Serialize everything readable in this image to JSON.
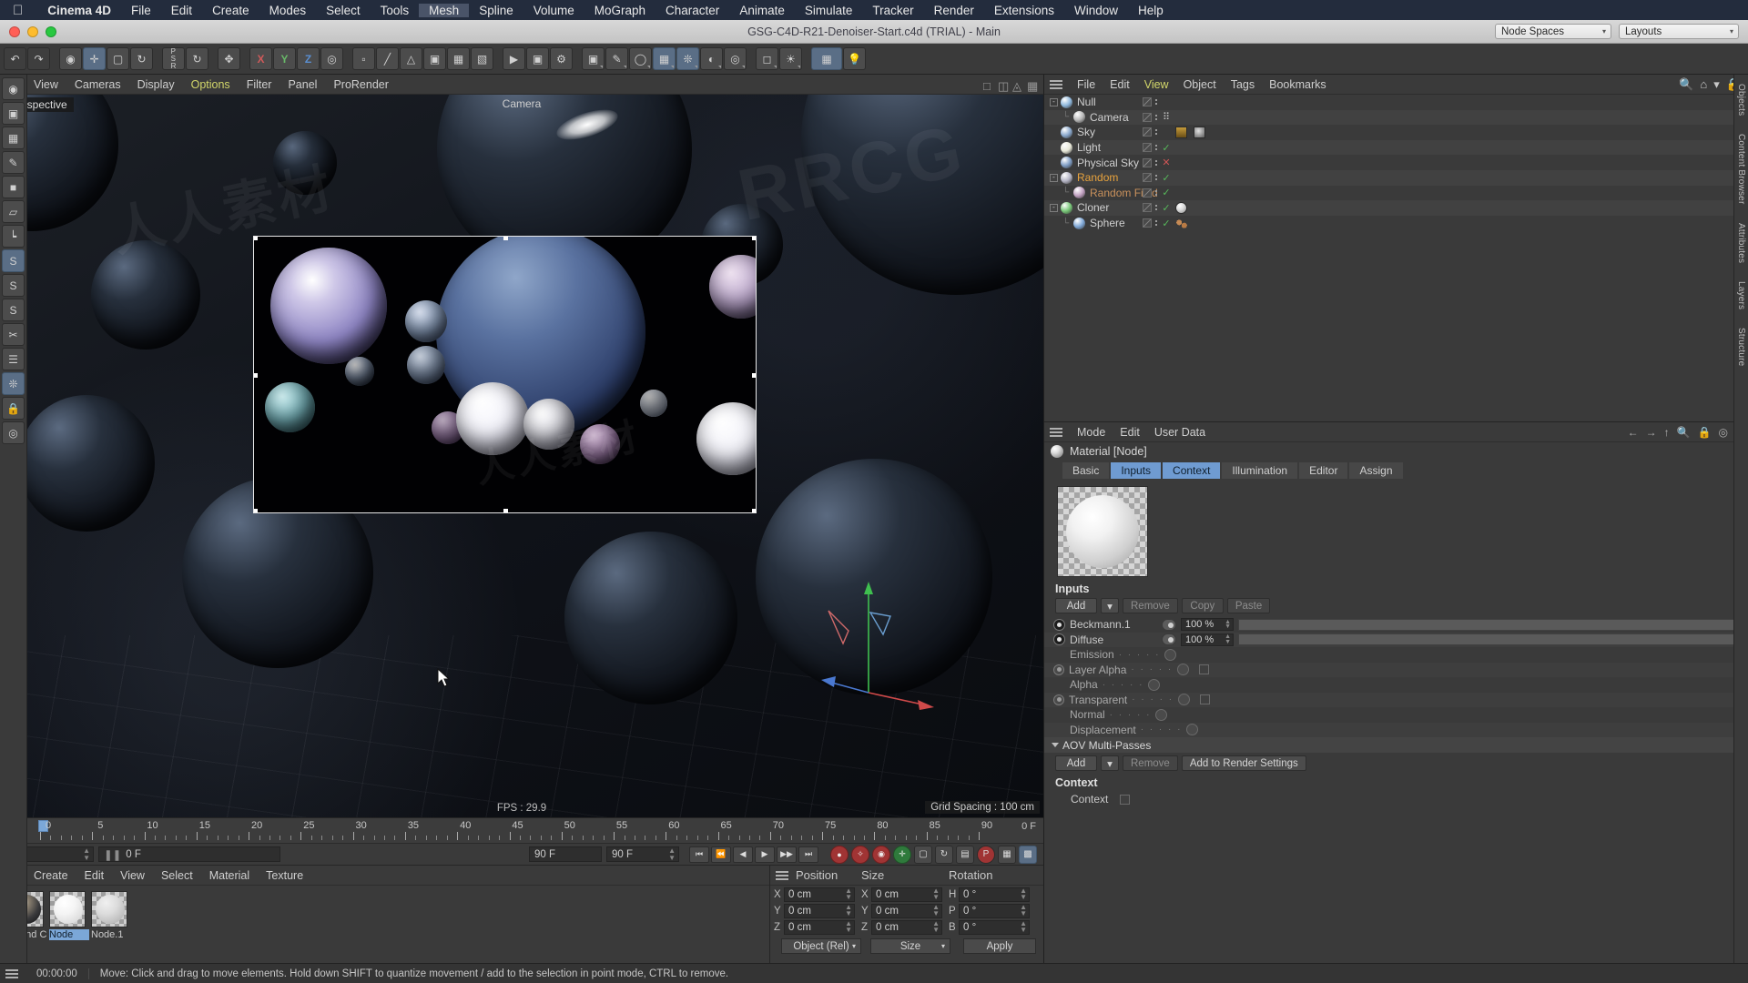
{
  "app": {
    "name": "Cinema 4D",
    "window_title": "GSG-C4D-R21-Denoiser-Start.c4d (TRIAL) - Main",
    "apple_logo": "apple-icon"
  },
  "menubar": {
    "items": [
      "File",
      "Edit",
      "Create",
      "Modes",
      "Select",
      "Tools",
      "Mesh",
      "Spline",
      "Volume",
      "MoGraph",
      "Character",
      "Animate",
      "Simulate",
      "Tracker",
      "Render",
      "Extensions",
      "Window",
      "Help"
    ],
    "active": "Mesh"
  },
  "titlebar": {
    "node_spaces": "Node Spaces",
    "layouts": "Layouts"
  },
  "viewport": {
    "menu": [
      "View",
      "Cameras",
      "Display",
      "Options",
      "Filter",
      "Panel",
      "ProRender"
    ],
    "highlighted": "Options",
    "label": "Perspective",
    "camera_label": "Camera",
    "fps": "FPS : 29.9",
    "grid_spacing": "Grid Spacing : 100 cm"
  },
  "timeline": {
    "ticks": [
      0,
      5,
      10,
      15,
      20,
      25,
      30,
      35,
      40,
      45,
      50,
      55,
      60,
      65,
      70,
      75,
      80,
      85,
      90
    ],
    "end_label": "0 F",
    "current_frame": "0 F",
    "preview_frame": "0 F",
    "range_start": "90 F",
    "range_end": "90 F"
  },
  "material_manager": {
    "menu": [
      "Create",
      "Edit",
      "View",
      "Select",
      "Material",
      "Texture"
    ],
    "materials": [
      {
        "name": "Round C",
        "selected": false,
        "kind": "chrome"
      },
      {
        "name": "Node",
        "selected": true,
        "kind": "white"
      },
      {
        "name": "Node.1",
        "selected": false,
        "kind": "grey"
      }
    ]
  },
  "coordinates": {
    "columns": [
      "Position",
      "Size",
      "Rotation"
    ],
    "rows": [
      {
        "p_axis": "X",
        "p_val": "0 cm",
        "s_axis": "X",
        "s_val": "0 cm",
        "r_axis": "H",
        "r_val": "0 °"
      },
      {
        "p_axis": "Y",
        "p_val": "0 cm",
        "s_axis": "Y",
        "s_val": "0 cm",
        "r_axis": "P",
        "r_val": "0 °"
      },
      {
        "p_axis": "Z",
        "p_val": "0 cm",
        "s_axis": "Z",
        "s_val": "0 cm",
        "r_axis": "B",
        "r_val": "0 °"
      }
    ],
    "mode_left": "Object (Rel)",
    "mode_right": "Size",
    "apply": "Apply"
  },
  "statusbar": {
    "time": "00:00:00",
    "message": "Move: Click and drag to move elements. Hold down SHIFT to quantize movement / add to the selection in point mode, CTRL to remove."
  },
  "object_manager": {
    "menu": [
      "File",
      "Edit",
      "View",
      "Object",
      "Tags",
      "Bookmarks"
    ],
    "highlighted": "View",
    "icons": [
      "search-icon",
      "home-icon"
    ],
    "objects": [
      {
        "name": "Null",
        "depth": 0,
        "expander": "-",
        "icon_color": "#8fb8dd",
        "tag": "",
        "tag2": ""
      },
      {
        "name": "Camera",
        "depth": 1,
        "expander": "",
        "icon_color": "#b8b8b8",
        "tag": "dots",
        "tag2": ""
      },
      {
        "name": "Sky",
        "depth": 0,
        "expander": "",
        "icon_color": "#8aa8cc",
        "tag": "",
        "tag2": "thumbs"
      },
      {
        "name": "Light",
        "depth": 0,
        "expander": "",
        "icon_color": "#e8e8d8",
        "tag": "check",
        "tag2": ""
      },
      {
        "name": "Physical Sky",
        "depth": 0,
        "expander": "",
        "icon_color": "#7f9dc4",
        "tag": "x",
        "tag2": ""
      },
      {
        "name": "Random",
        "depth": 0,
        "expander": "-",
        "icon_color": "#b4b4c4",
        "tag": "check",
        "tag2": "",
        "color": "orange"
      },
      {
        "name": "Random Field",
        "depth": 1,
        "expander": "",
        "icon_color": "#c0a0c0",
        "tag": "check",
        "tag2": "",
        "color": "lorange"
      },
      {
        "name": "Cloner",
        "depth": 0,
        "expander": "-",
        "icon_color": "#78c878",
        "tag": "check",
        "tag2": "ball"
      },
      {
        "name": "Sphere",
        "depth": 1,
        "expander": "",
        "icon_color": "#7fa8d8",
        "tag": "check",
        "tag2": "beads"
      }
    ]
  },
  "attribute_manager": {
    "menu": [
      "Mode",
      "Edit",
      "User Data"
    ],
    "title": "Material [Node]",
    "tabs": [
      {
        "label": "Basic",
        "selected": false
      },
      {
        "label": "Inputs",
        "selected": true
      },
      {
        "label": "Context",
        "selected": true
      },
      {
        "label": "Illumination",
        "selected": false
      },
      {
        "label": "Editor",
        "selected": false
      },
      {
        "label": "Assign",
        "selected": false
      }
    ],
    "inputs_section": "Inputs",
    "buttons": [
      {
        "label": "Add",
        "dim": false
      },
      {
        "label": "Remove",
        "dim": true
      },
      {
        "label": "Copy",
        "dim": true
      },
      {
        "label": "Paste",
        "dim": true
      }
    ],
    "input_rows": [
      {
        "name": "Beckmann.1",
        "value": "100 %",
        "eye": true,
        "link": true,
        "slider": true
      },
      {
        "name": "Diffuse",
        "value": "100 %",
        "eye": true,
        "link": true,
        "slider": true
      }
    ],
    "property_rows": [
      {
        "name": "Emission",
        "radio": false,
        "circle": true,
        "square": false
      },
      {
        "name": "Layer Alpha",
        "radio": true,
        "circle": true,
        "square": true
      },
      {
        "name": "Alpha",
        "radio": false,
        "circle": true,
        "square": false
      },
      {
        "name": "Transparent",
        "radio": true,
        "circle": true,
        "square": true
      },
      {
        "name": "Normal",
        "radio": false,
        "circle": true,
        "square": false
      },
      {
        "name": "Displacement",
        "radio": false,
        "circle": true,
        "square": false
      }
    ],
    "aov_section": "AOV Multi-Passes",
    "aov_buttons": [
      {
        "label": "Add",
        "dim": false
      },
      {
        "label": "Remove",
        "dim": true
      },
      {
        "label": "Add to Render Settings",
        "dim": false
      }
    ],
    "context_section": "Context",
    "context_row": {
      "name": "Context",
      "square": true
    }
  },
  "right_strip": [
    "Objects",
    "Content Browser",
    "Attributes",
    "Layers",
    "Structure"
  ],
  "colors": {
    "accent_blue": "#6f9bd1",
    "selection_blue": "#7ba7d8",
    "menu_bar": "#232c3d",
    "panel_bg": "#3a3a3a",
    "highlight_yellow": "#d2d66a",
    "orange_object": "#e8a33d"
  }
}
